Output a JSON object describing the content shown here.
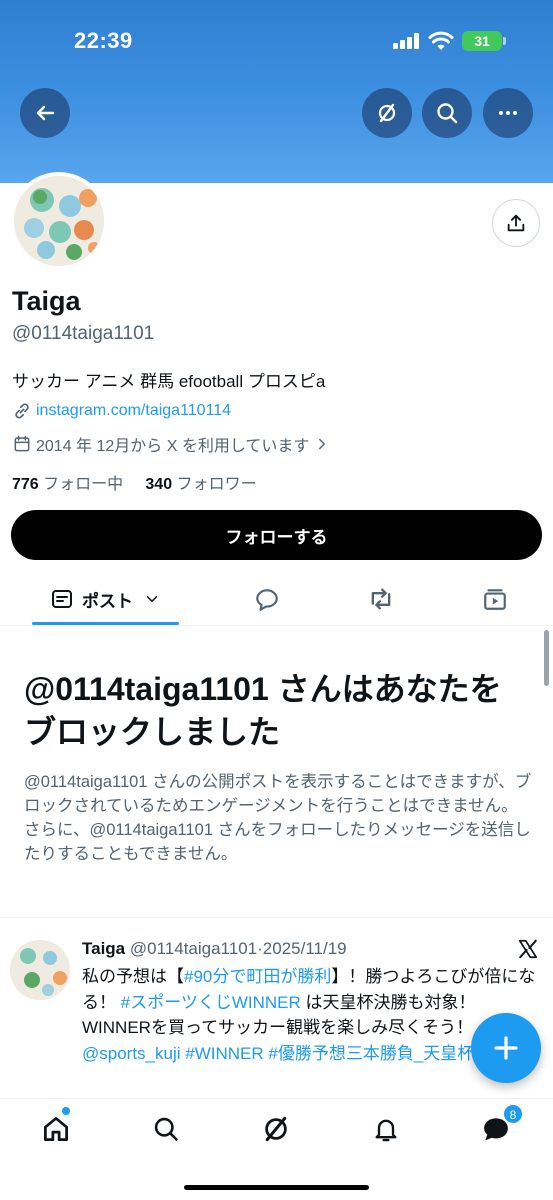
{
  "status_bar": {
    "time": "22:39",
    "battery": "31"
  },
  "header": {
    "back_icon": "arrow-left-icon",
    "grok_icon": "grok-icon",
    "search_icon": "search-icon",
    "more_icon": "more-icon"
  },
  "profile": {
    "name": "Taiga",
    "handle": "@0114taiga1101",
    "bio": "サッカー アニメ 群馬 efootball プロスピa",
    "link": "instagram.com/taiga110114",
    "joined": "2014 年 12月から X を利用しています",
    "following_count": "776",
    "following_label": "フォロー中",
    "followers_count": "340",
    "followers_label": "フォロワー",
    "follow_button": "フォローする"
  },
  "tabs": {
    "posts_label": "ポスト"
  },
  "blocked": {
    "title": "@0114taiga1101 さんはあなたをブロックしました",
    "text": "@0114taiga1101 さんの公開ポストを表示することはできますが、ブロックされているためエンゲージメントを行うことはできません。さらに、@0114taiga1101 さんをフォローしたりメッセージを送信したりすることもできません。"
  },
  "tweet": {
    "author": "Taiga",
    "handle": "@0114taiga1101",
    "sep": "·",
    "date": "2025/11/19",
    "body_1": "私の予想は【",
    "hashtag_1": "#90分で町田が勝利",
    "body_2": "】！勝つよろこびが倍になる！ ",
    "hashtag_2": "#スポーツくじWINNER",
    "body_3": " は天皇杯決勝も対象！WINNERを買ってサッカー観戦を楽しみ尽くそう！ ",
    "mention": "@sports_kuji",
    "hashtag_3": " #WINNER",
    "hashtag_4": " #優勝予想三本勝負_天皇杯決勝"
  },
  "bottom_nav": {
    "messages_badge": "8"
  },
  "colors": {
    "accent": "#1d9bf0",
    "header_blue": "#3d8fe0",
    "text": "#0f1419",
    "muted": "#536471"
  }
}
